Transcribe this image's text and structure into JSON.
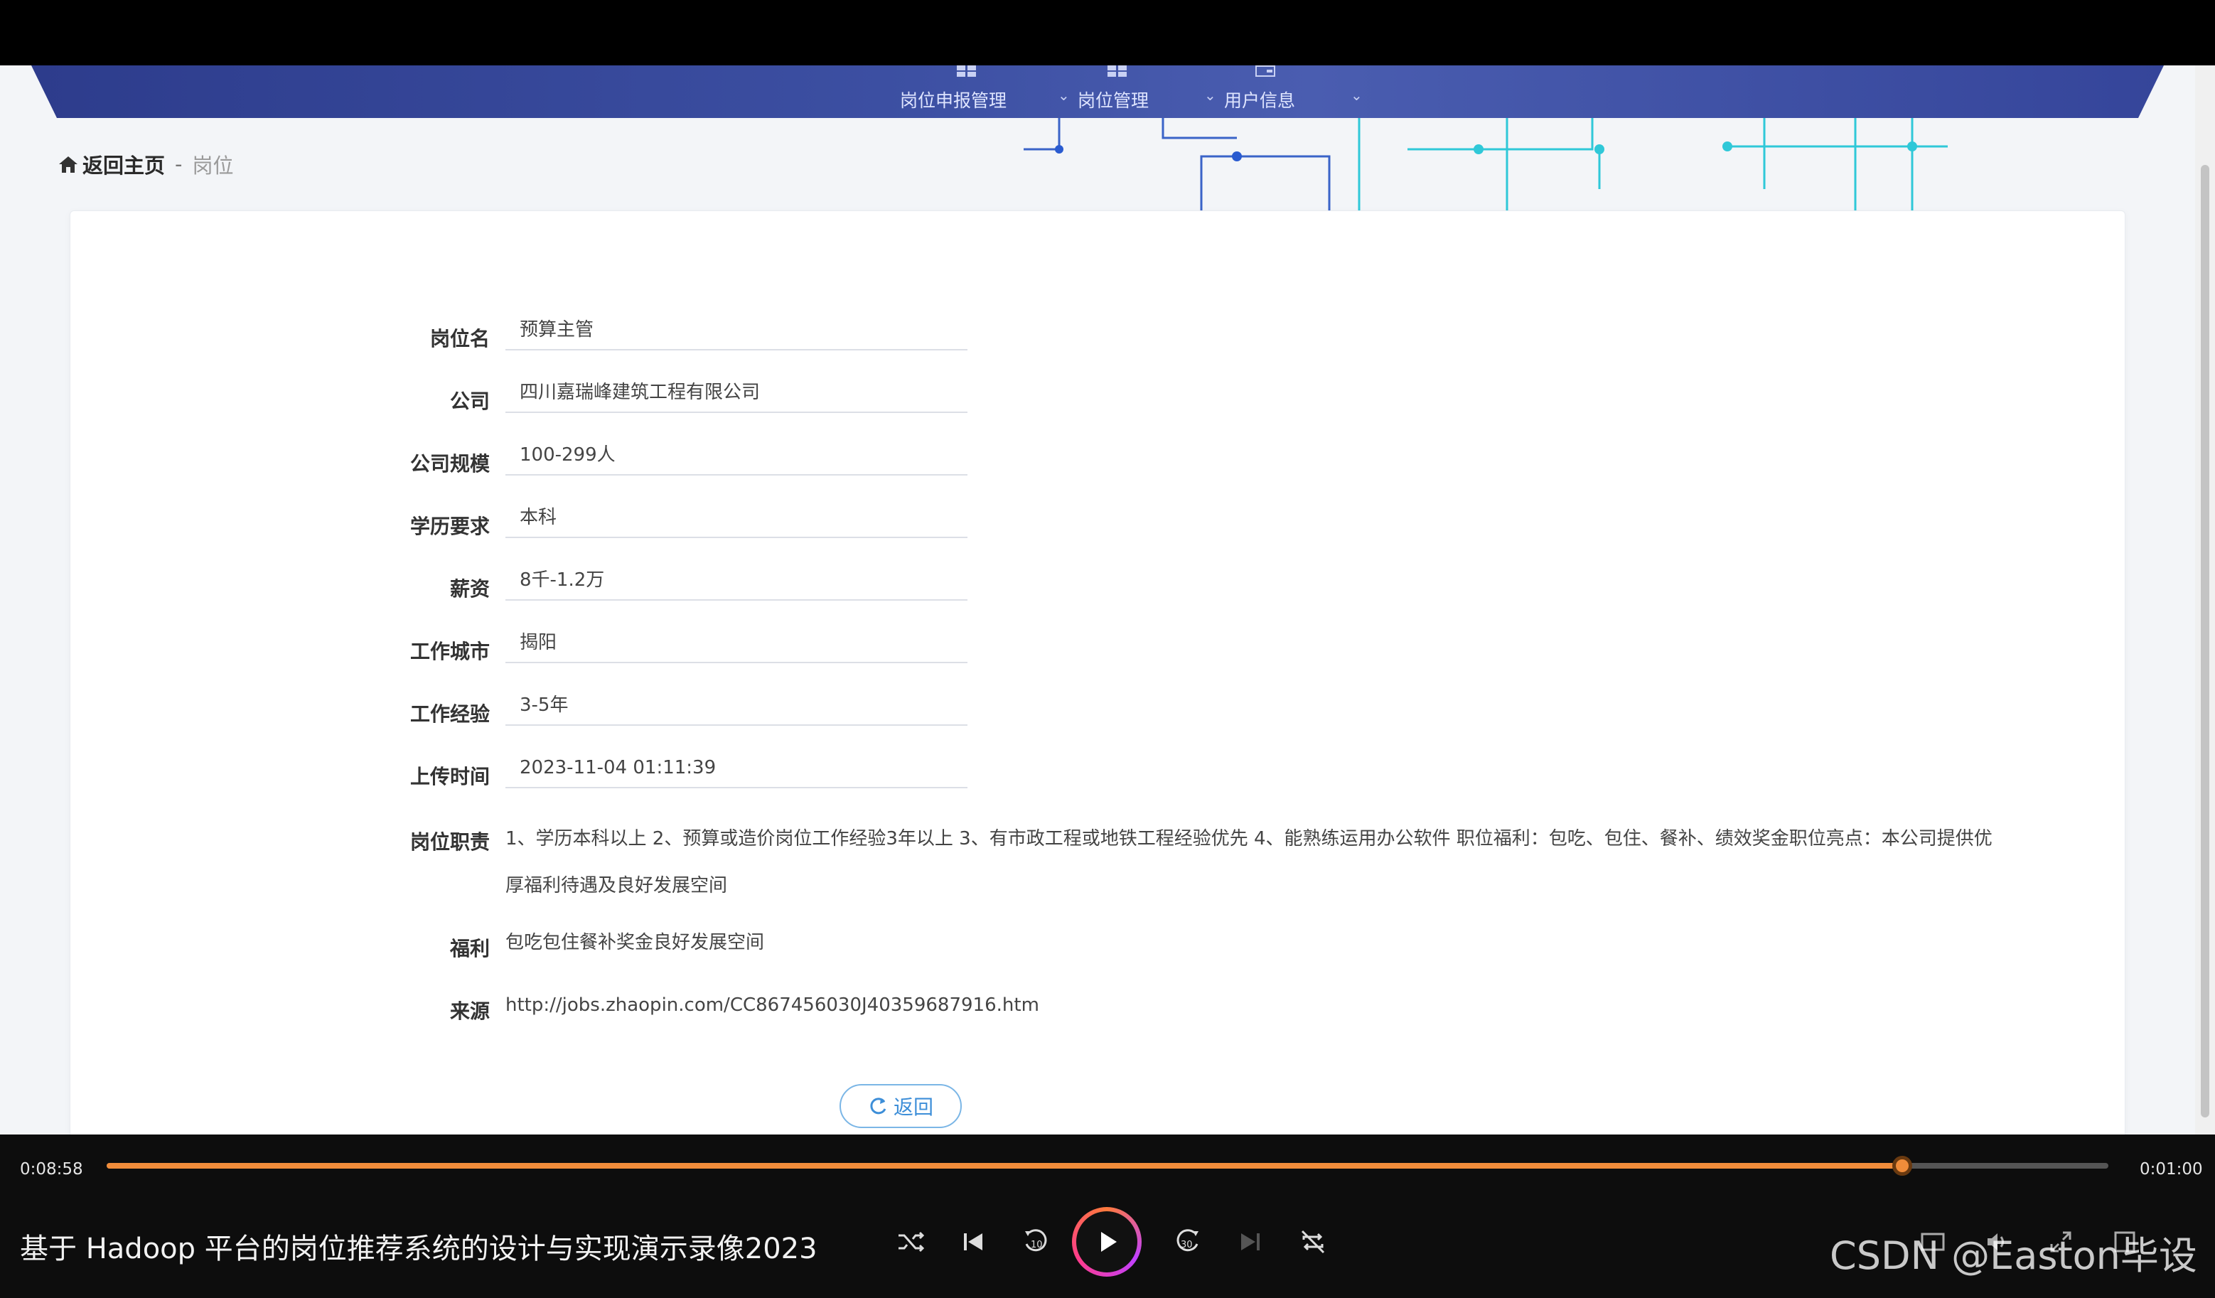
{
  "nav": {
    "items": [
      {
        "label": "岗位申报管理"
      },
      {
        "label": "岗位管理"
      },
      {
        "label": "用户信息"
      }
    ]
  },
  "breadcrumb": {
    "home": "返回主页",
    "separator": "-",
    "current": "岗位"
  },
  "form": {
    "fields": [
      {
        "label": "岗位名",
        "value": "预算主管"
      },
      {
        "label": "公司",
        "value": "四川嘉瑞峰建筑工程有限公司"
      },
      {
        "label": "公司规模",
        "value": "100-299人"
      },
      {
        "label": "学历要求",
        "value": "本科"
      },
      {
        "label": "薪资",
        "value": "8千-1.2万"
      },
      {
        "label": "工作城市",
        "value": "揭阳"
      },
      {
        "label": "工作经验",
        "value": "3-5年"
      },
      {
        "label": "上传时间",
        "value": "2023-11-04 01:11:39"
      }
    ],
    "duties": {
      "label": "岗位职责",
      "value": "1、学历本科以上 2、预算或造价岗位工作经验3年以上 3、有市政工程或地铁工程经验优先 4、能熟练运用办公软件 职位福利：包吃、包住、餐补、绩效奖金职位亮点：本公司提供优厚福利待遇及良好发展空间"
    },
    "benefits": {
      "label": "福利",
      "value": "包吃包住餐补奖金良好发展空间"
    },
    "source": {
      "label": "来源",
      "value": "http://jobs.zhaopin.com/CC867456030J40359687916.htm"
    },
    "back_label": "返回"
  },
  "player": {
    "current_time": "0:08:58",
    "total_time": "0:01:00",
    "progress": 0.897,
    "title": "基于 Hadoop 平台的岗位推荐系统的设计与实现演示录像2023",
    "accent_color": "#f08c3a"
  },
  "watermark": "CSDN @Easton毕设"
}
